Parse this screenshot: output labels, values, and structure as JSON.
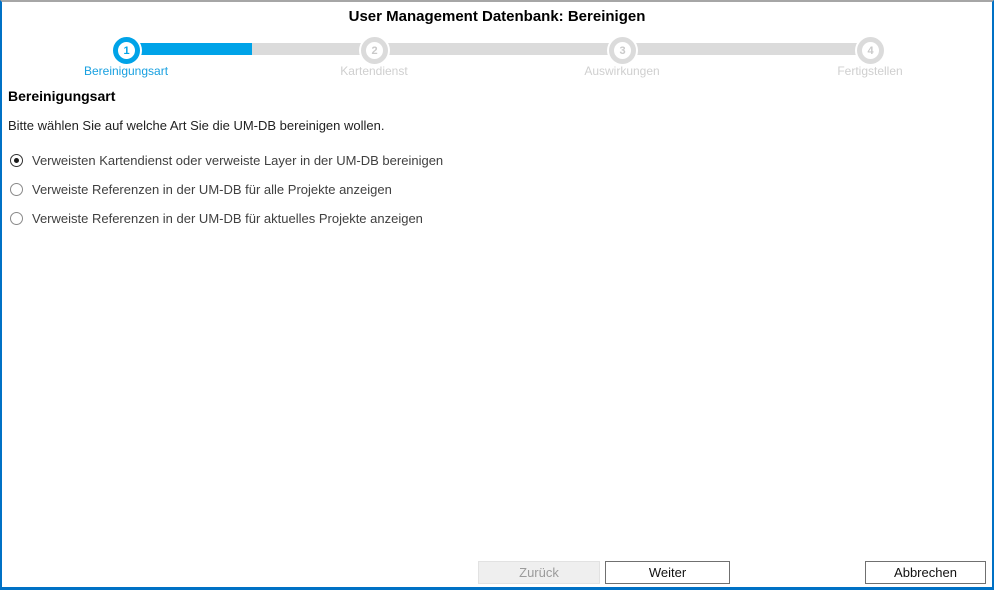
{
  "dialog": {
    "title": "User Management Datenbank: Bereinigen"
  },
  "wizard": {
    "steps": [
      {
        "number": "1",
        "label": "Bereinigungsart",
        "state": "active"
      },
      {
        "number": "2",
        "label": "Kartendienst",
        "state": "inactive"
      },
      {
        "number": "3",
        "label": "Auswirkungen",
        "state": "inactive"
      },
      {
        "number": "4",
        "label": "Fertigstellen",
        "state": "inactive"
      }
    ],
    "progress_percent": 17
  },
  "content": {
    "heading": "Bereinigungsart",
    "instruction": "Bitte wählen Sie auf welche Art Sie die UM-DB bereinigen wollen.",
    "options": [
      {
        "label": "Verweisten Kartendienst oder verweiste Layer in der UM-DB bereinigen",
        "selected": true
      },
      {
        "label": "Verweiste Referenzen in der UM-DB für alle Projekte anzeigen",
        "selected": false
      },
      {
        "label": "Verweiste Referenzen in der UM-DB für aktuelles Projekte anzeigen",
        "selected": false
      }
    ]
  },
  "footer": {
    "back_label": "Zurück",
    "back_enabled": false,
    "next_label": "Weiter",
    "cancel_label": "Abbrechen"
  },
  "colors": {
    "accent_blue": "#00A3E8",
    "active_label_blue": "#18A0E0",
    "border_blue": "#0071C5",
    "top_border_gray": "#A6A6A6",
    "inactive_gray": "#DBDBDB"
  }
}
